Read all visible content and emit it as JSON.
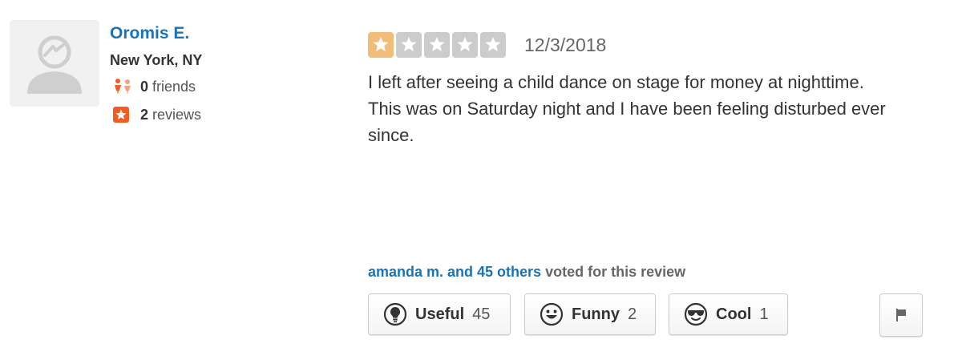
{
  "user": {
    "name": "Oromis E.",
    "location": "New York, NY",
    "friends_count": "0",
    "friends_label": "friends",
    "reviews_count": "2",
    "reviews_label": "reviews"
  },
  "review": {
    "rating": 1,
    "max_rating": 5,
    "date": "12/3/2018",
    "text": "I left after seeing a child dance on stage for money at nighttime. This was on Saturday night and I have been feeling disturbed ever since."
  },
  "votes": {
    "voters": "amanda m. and 45 others",
    "suffix": " voted for this review"
  },
  "buttons": {
    "useful": {
      "label": "Useful",
      "count": "45",
      "icon": "lightbulb-icon"
    },
    "funny": {
      "label": "Funny",
      "count": "2",
      "icon": "smile-face-icon"
    },
    "cool": {
      "label": "Cool",
      "count": "1",
      "icon": "sunglasses-face-icon"
    },
    "flag": {
      "icon": "flag-icon"
    }
  },
  "colors": {
    "link_blue": "#1a73b8",
    "star_filled": "#f2bd79",
    "star_empty": "#cccccc",
    "review_badge": "#f15c22",
    "friends_icon": "#f15c22"
  }
}
